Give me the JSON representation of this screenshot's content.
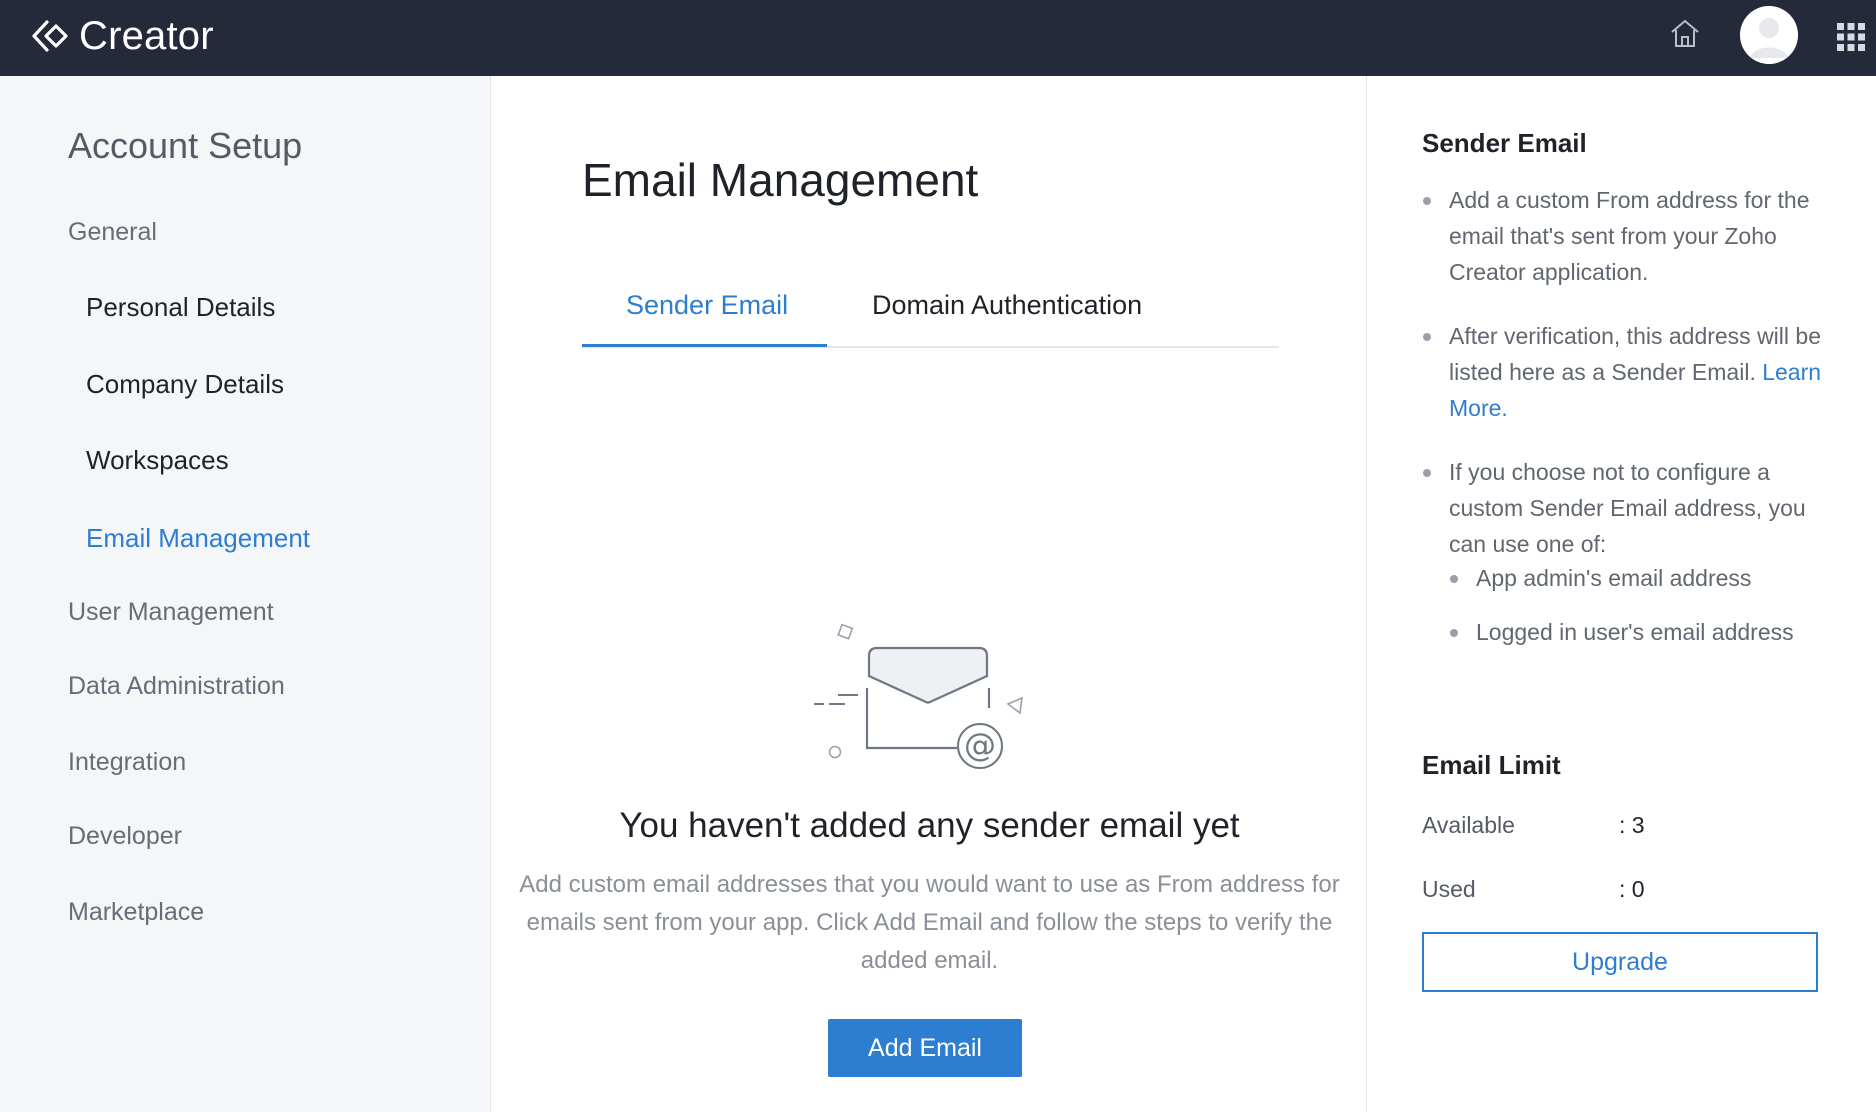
{
  "app": {
    "name": "Creator"
  },
  "sidebar": {
    "heading": "Account Setup",
    "items": [
      {
        "label": "General",
        "level": "group"
      },
      {
        "label": "Personal Details",
        "level": "sub"
      },
      {
        "label": "Company Details",
        "level": "sub"
      },
      {
        "label": "Workspaces",
        "level": "sub"
      },
      {
        "label": "Email Management",
        "level": "sub",
        "active": true
      },
      {
        "label": "User Management",
        "level": "group"
      },
      {
        "label": "Data Administration",
        "level": "group"
      },
      {
        "label": "Integration",
        "level": "group"
      },
      {
        "label": "Developer",
        "level": "group"
      },
      {
        "label": "Marketplace",
        "level": "group"
      }
    ]
  },
  "main": {
    "title": "Email Management",
    "tabs": [
      {
        "label": "Sender Email",
        "active": true
      },
      {
        "label": "Domain Authentication",
        "active": false
      }
    ],
    "empty_state": {
      "title": "You haven't added any sender email yet",
      "description": "Add custom email addresses that you would want to use as From address for emails sent from your app. Click Add Email and follow the steps to verify the added email.",
      "button_label": "Add Email"
    }
  },
  "right_panel": {
    "sender_title": "Sender Email",
    "bullets": {
      "b1": "Add a custom From address for the email that's sent from your Zoho Creator application.",
      "b2": "After verification, this address will be listed here as a Sender Email.",
      "b2_link": "Learn More",
      "b2_link_suffix": ".",
      "b3": "If you choose not to configure a custom Sender Email address, you can use one of:",
      "sub1": "App admin's email address",
      "sub2": "Logged in user's email address"
    },
    "limit_title": "Email Limit",
    "available_label": "Available",
    "available_value": ": 3",
    "used_label": "Used",
    "used_value": ": 0",
    "upgrade_label": "Upgrade"
  },
  "colors": {
    "topbar": "#242a3a",
    "accent": "#2d7ed1",
    "sidebar_bg": "#f5f6f8"
  },
  "icons": [
    "creator-logo-icon",
    "home-icon",
    "user-avatar",
    "apps-grid-icon",
    "empty-email-illustration"
  ]
}
